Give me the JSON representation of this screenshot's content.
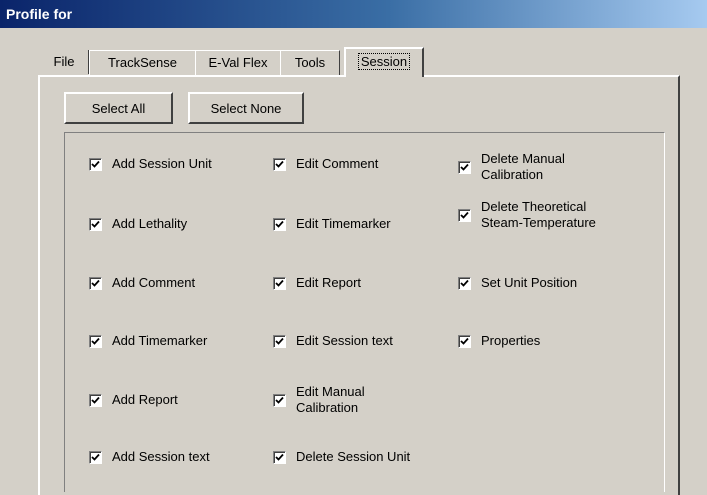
{
  "window": {
    "title": "Profile for"
  },
  "tabs": [
    {
      "label": "File"
    },
    {
      "label": "TrackSense"
    },
    {
      "label": "E-Val Flex"
    },
    {
      "label": "Tools"
    },
    {
      "label": "Session"
    }
  ],
  "active_tab": "Session",
  "buttons": {
    "select_all": "Select All",
    "select_none": "Select None"
  },
  "checkboxes": {
    "col1": [
      {
        "label": "Add Session Unit",
        "checked": true
      },
      {
        "label": "Add Lethality",
        "checked": true
      },
      {
        "label": "Add Comment",
        "checked": true
      },
      {
        "label": "Add Timemarker",
        "checked": true
      },
      {
        "label": "Add Report",
        "checked": true
      },
      {
        "label": "Add Session text",
        "checked": true
      }
    ],
    "col2": [
      {
        "label": "Edit Comment",
        "checked": true
      },
      {
        "label": "Edit Timemarker",
        "checked": true
      },
      {
        "label": "Edit Report",
        "checked": true
      },
      {
        "label": "Edit Session text",
        "checked": true
      },
      {
        "label": "Edit Manual Calibration",
        "checked": true
      },
      {
        "label": "Delete Session Unit",
        "checked": true
      }
    ],
    "col3": [
      {
        "label": "Delete Manual Calibration",
        "checked": true
      },
      {
        "label": "Delete Theoretical Steam-Temperature",
        "checked": true
      },
      {
        "label": "Set Unit Position",
        "checked": true
      },
      {
        "label": "Properties",
        "checked": true
      }
    ]
  }
}
